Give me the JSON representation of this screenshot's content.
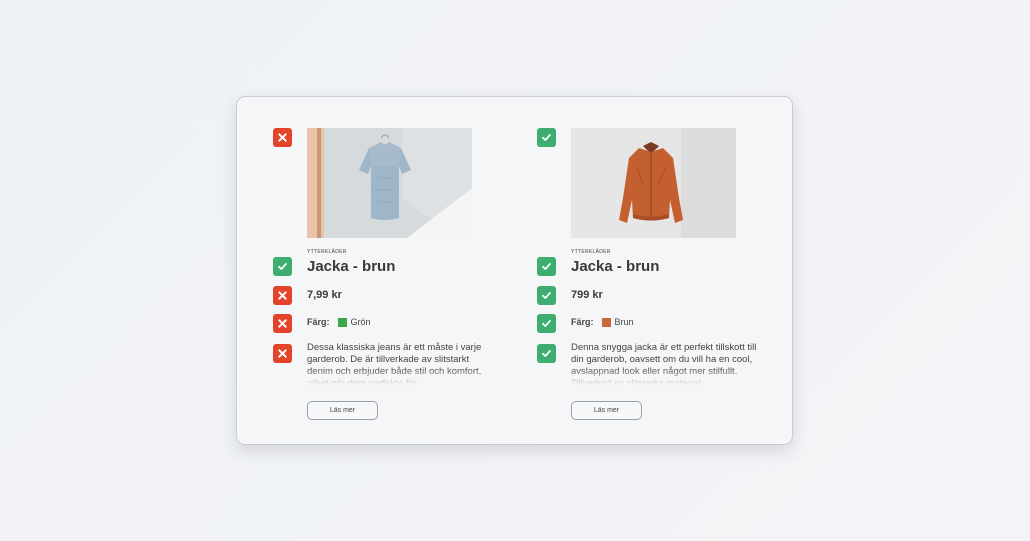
{
  "colors": {
    "no": "#e2432a",
    "yes": "#3dae6f"
  },
  "products": [
    {
      "image_check": "cross-icon",
      "title_check": "check-icon",
      "price_check": "cross-icon",
      "color_check": "cross-icon",
      "desc_check": "cross-icon",
      "category": "YTTERKLÄDER",
      "title": "Jacka - brun",
      "price": "7,99 kr",
      "color_label": "Färg:",
      "color_name": "Grön",
      "swatch": "#3aa84a",
      "description": "Dessa klassiska jeans är ett måste i varje garderob. De är tillverkade av slitstarkt denim och erbjuder både stil och komfort, vilket gör dem perfekta för",
      "button": "Läs mer"
    },
    {
      "image_check": "check-icon",
      "title_check": "check-icon",
      "price_check": "check-icon",
      "color_check": "check-icon",
      "desc_check": "check-icon",
      "category": "YTTERKLÄDER",
      "title": "Jacka - brun",
      "price": "799 kr",
      "color_label": "Färg:",
      "color_name": "Brun",
      "swatch": "#c8673a",
      "description": "Denna snygga jacka är ett perfekt tillskott till din garderob, oavsett om du vill ha en cool, avslappnad look eller något mer stilfullt. Tillverkad av slitstarka material",
      "button": "Läs mer"
    }
  ]
}
